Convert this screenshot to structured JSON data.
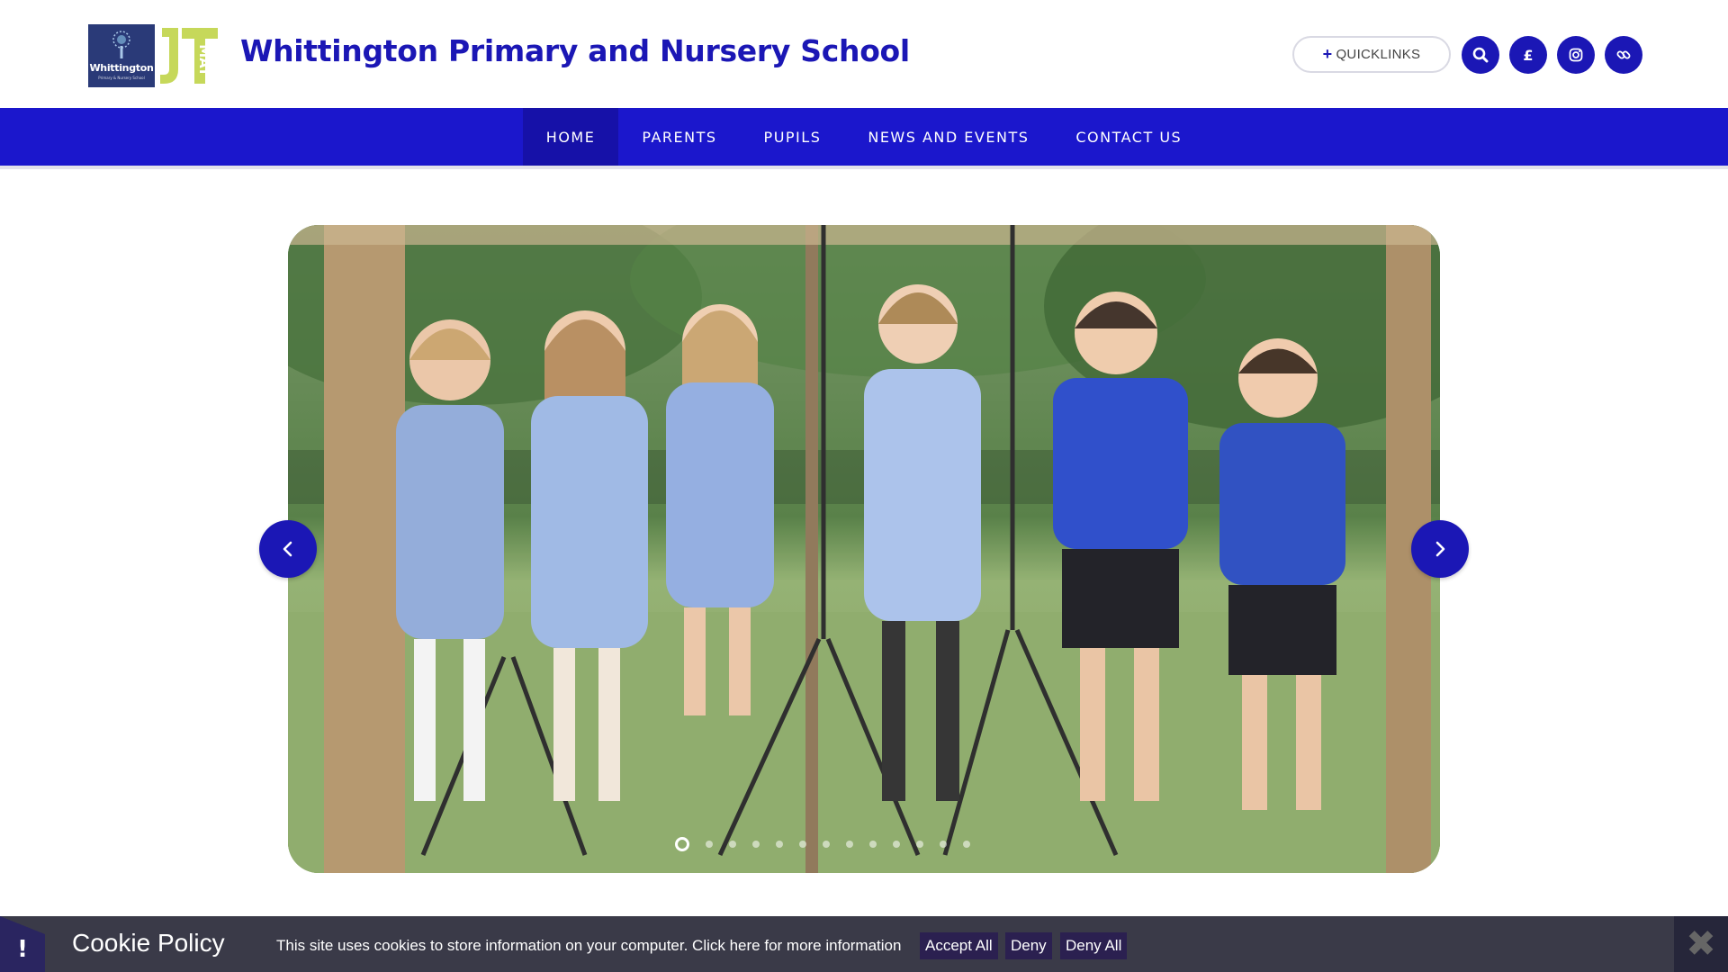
{
  "header": {
    "site_title": "Whittington Primary and Nursery School",
    "school_logo_name": "Whittington",
    "school_logo_sub": "Primary & Nursery School",
    "mat_logo_text": "JTMAT",
    "quicklinks_label": "QUICKLINKS",
    "icons": [
      "search-icon",
      "pound-icon",
      "instagram-icon",
      "link-icon"
    ],
    "brand_color": "#1b17b5"
  },
  "nav": {
    "items": [
      {
        "label": "HOME",
        "active": true
      },
      {
        "label": "PARENTS",
        "active": false
      },
      {
        "label": "PUPILS",
        "active": false
      },
      {
        "label": "NEWS AND EVENTS",
        "active": false
      },
      {
        "label": "CONTACT US",
        "active": false
      }
    ]
  },
  "slider": {
    "slide_count": 13,
    "active_slide": 1,
    "prev_icon": "chevron-left-icon",
    "next_icon": "chevron-right-icon"
  },
  "cookie": {
    "title": "Cookie Policy",
    "message": "This site uses cookies to store information on your computer. Click here for more information",
    "accept_all": "Accept All",
    "deny": "Deny",
    "deny_all": "Deny All",
    "flag_symbol": "!",
    "close_symbol": "✖"
  }
}
